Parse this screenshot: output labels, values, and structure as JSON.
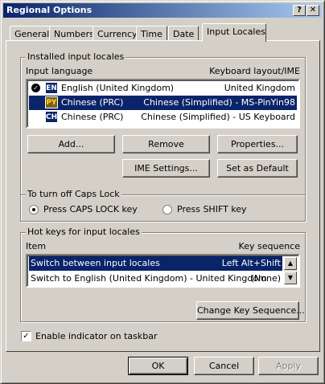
{
  "window": {
    "title": "Regional Options",
    "help_glyph": "?",
    "close_glyph": "✕"
  },
  "tabs": [
    {
      "label": "General"
    },
    {
      "label": "Numbers"
    },
    {
      "label": "Currency"
    },
    {
      "label": "Time"
    },
    {
      "label": "Date"
    },
    {
      "label": "Input Locales",
      "active": true
    }
  ],
  "installed": {
    "group_label": "Installed input locales",
    "col_language": "Input language",
    "col_layout": "Keyboard layout/IME",
    "rows": [
      {
        "icon": "EN",
        "language": "English (United Kingdom)",
        "layout": "United Kingdom",
        "default": true,
        "selected": false
      },
      {
        "icon": "PY",
        "language": "Chinese (PRC)",
        "layout": "Chinese (Simplified) - MS-PinYin98",
        "selected": true
      },
      {
        "icon": "CH",
        "language": "Chinese (PRC)",
        "layout": "Chinese (Simplified) - US Keyboard",
        "selected": false
      }
    ],
    "buttons": {
      "add": "Add...",
      "remove": "Remove",
      "properties": "Properties...",
      "ime_settings": "IME Settings...",
      "set_default": "Set as Default"
    }
  },
  "caps_lock": {
    "group_label": "To turn off Caps Lock",
    "option_caps": "Press CAPS LOCK key",
    "option_shift": "Press SHIFT key",
    "selected": "caps"
  },
  "hotkeys": {
    "group_label": "Hot keys for input locales",
    "col_item": "Item",
    "col_sequence": "Key sequence",
    "rows": [
      {
        "item": "Switch between input locales",
        "sequence": "Left Alt+Shift",
        "selected": true
      },
      {
        "item": "Switch to English (United Kingdom) - United Kingdom",
        "sequence": "(None)",
        "selected": false
      }
    ],
    "change_button": "Change Key Sequence..."
  },
  "indicator": {
    "label": "Enable indicator on taskbar",
    "checked": true
  },
  "footer": {
    "ok": "OK",
    "cancel": "Cancel",
    "apply": "Apply"
  },
  "colors": {
    "selection": "#0a246a",
    "face": "#d4d0c8"
  }
}
